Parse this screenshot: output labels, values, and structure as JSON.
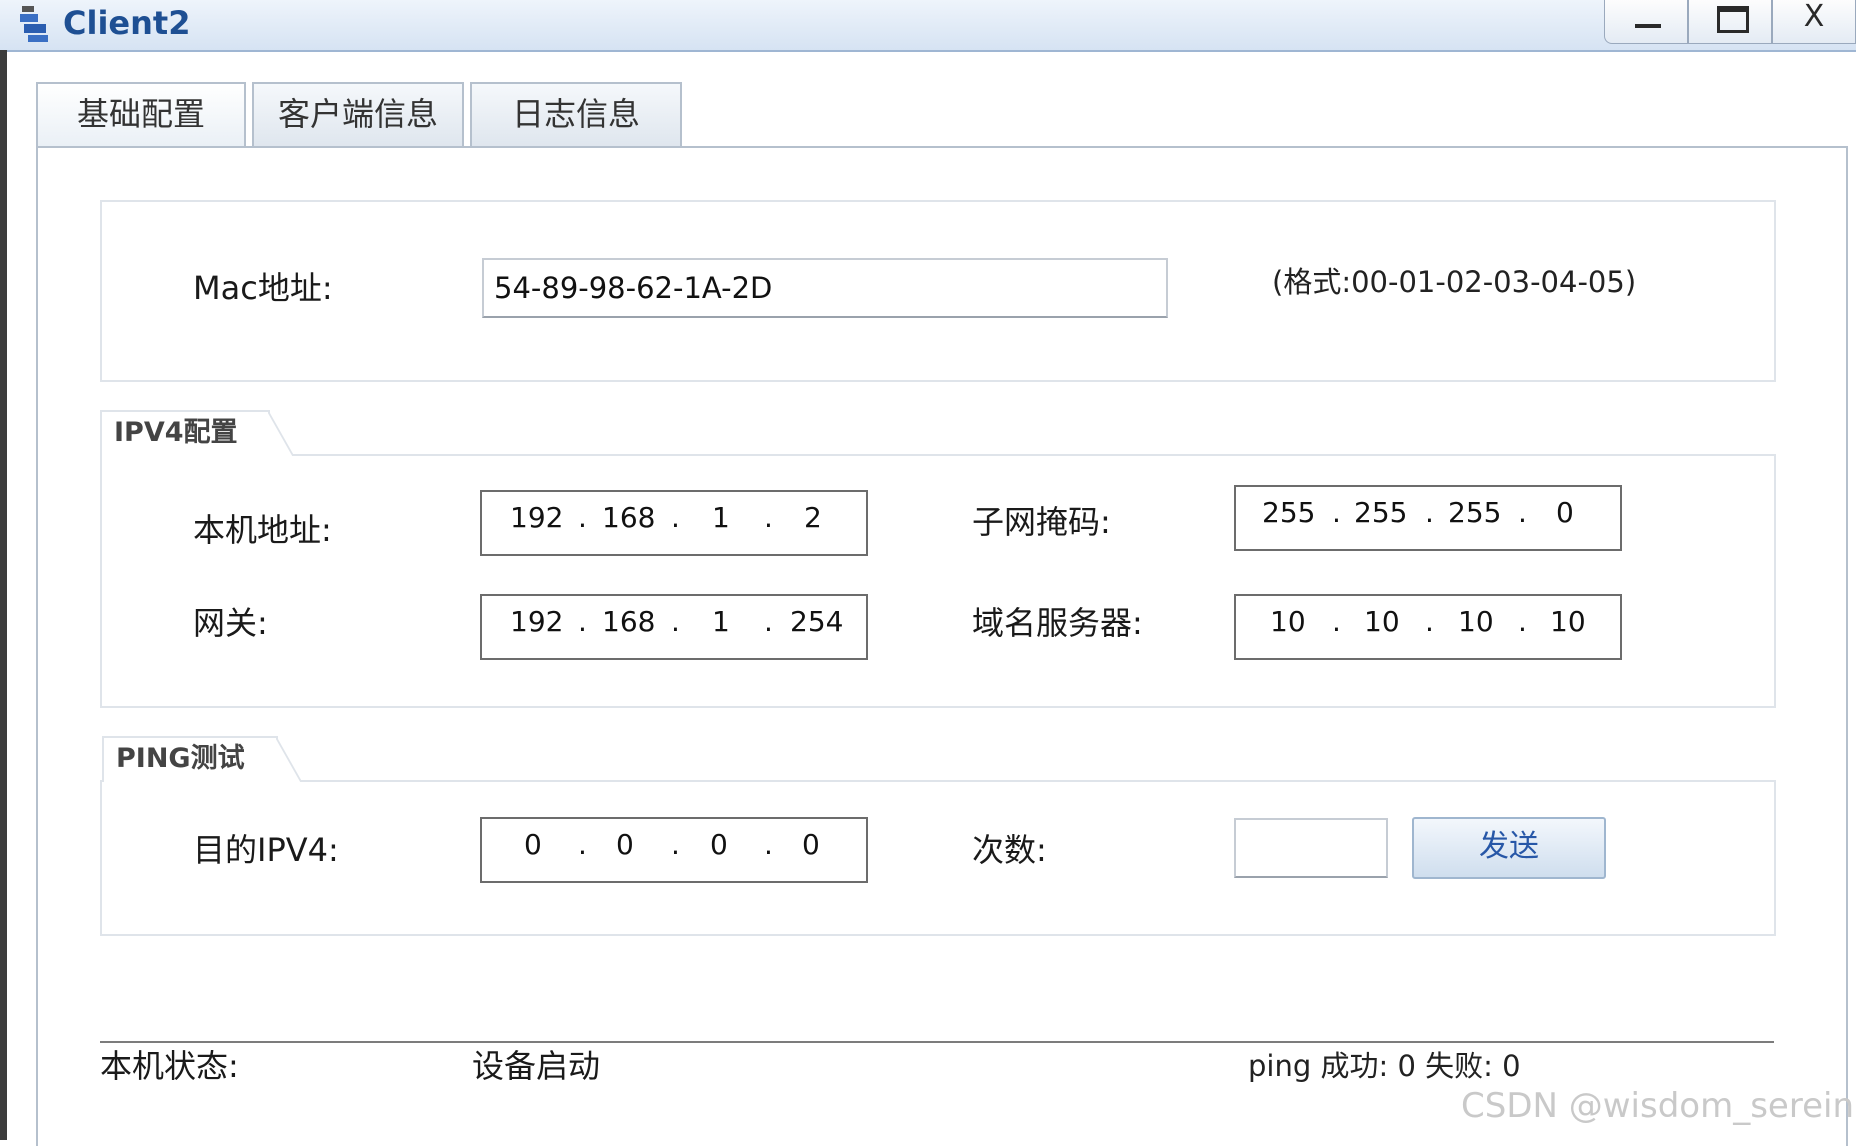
{
  "window": {
    "title": "Client2",
    "close_label": "X"
  },
  "tabs": [
    {
      "label": "基础配置"
    },
    {
      "label": "客户端信息"
    },
    {
      "label": "日志信息"
    }
  ],
  "mac_section": {
    "label": "Mac地址:",
    "value": "54-89-98-62-1A-2D",
    "format_hint": "(格式:00-01-02-03-04-05)"
  },
  "ipv4": {
    "title": "IPV4配置",
    "local_label": "本机地址:",
    "local": [
      "192",
      "168",
      "1",
      "2"
    ],
    "mask_label": "子网掩码:",
    "mask": [
      "255",
      "255",
      "255",
      "0"
    ],
    "gateway_label": "网关:",
    "gateway": [
      "192",
      "168",
      "1",
      "254"
    ],
    "dns_label": "域名服务器:",
    "dns": [
      "10",
      "10",
      "10",
      "10"
    ]
  },
  "ping": {
    "title": "PING测试",
    "dest_label": "目的IPV4:",
    "dest": [
      "0",
      "0",
      "0",
      "0"
    ],
    "count_label": "次数:",
    "count_value": "",
    "send_label": "发送"
  },
  "status": {
    "label": "本机状态:",
    "value": "设备启动",
    "ping_result": "ping 成功: 0 失败: 0"
  },
  "watermark": "CSDN @wisdom_serein"
}
